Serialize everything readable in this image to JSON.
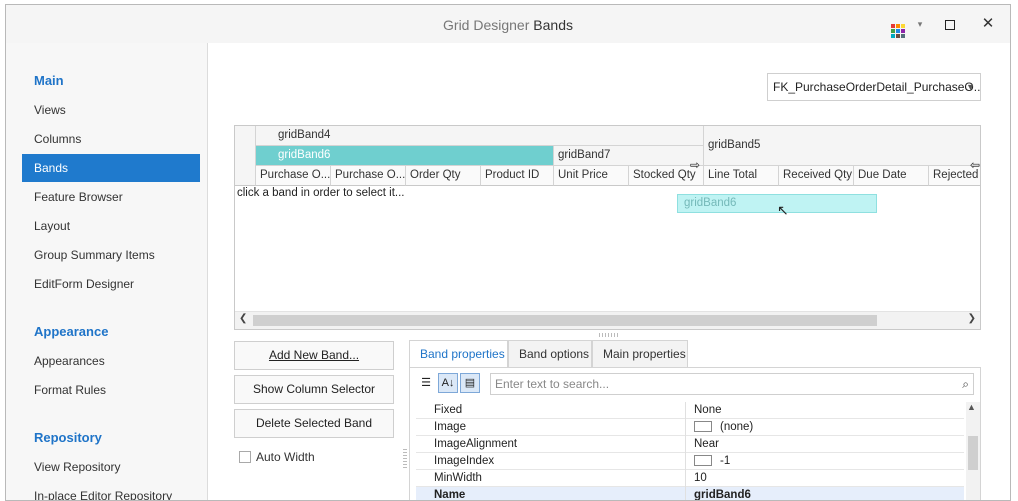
{
  "titlebar": {
    "title_part1": "Grid Designer",
    "title_part2": "Bands",
    "palette_icon": "palette-icon",
    "menu_arrow": "▾",
    "maximize": "maximize-icon",
    "close": "✕"
  },
  "sidebar": {
    "groups": [
      {
        "label": "Main"
      },
      {
        "label": "Appearance"
      },
      {
        "label": "Repository"
      }
    ],
    "items": [
      {
        "label": "Views"
      },
      {
        "label": "Columns"
      },
      {
        "label": "Bands"
      },
      {
        "label": "Feature Browser"
      },
      {
        "label": "Layout"
      },
      {
        "label": "Group Summary Items"
      },
      {
        "label": "EditForm Designer"
      },
      {
        "label": "Appearances"
      },
      {
        "label": "Format Rules"
      },
      {
        "label": "View Repository"
      },
      {
        "label": "In-place Editor Repository"
      }
    ],
    "selected_color": "#1f7acd"
  },
  "combo": {
    "value": "FK_PurchaseOrderDetail_PurchaseO..."
  },
  "grid": {
    "bands": {
      "band4": "gridBand4",
      "band6": "gridBand6",
      "band7": "gridBand7",
      "band5": "gridBand5"
    },
    "columns": [
      "Purchase O...",
      "Purchase O...",
      "Order Qty",
      "Product ID",
      "Unit Price",
      "Stocked Qty",
      "Line Total",
      "Received Qty",
      "Due Date",
      "Rejected Qty"
    ],
    "hint": "click a band in order to select it...",
    "dragging_band": "gridBand6",
    "selected_band_color": "#6fcfcf"
  },
  "buttons": {
    "add_new_band": "Add New Band...",
    "show_column_selector": "Show Column Selector",
    "delete_selected_band": "Delete Selected Band"
  },
  "auto_width": {
    "label": "Auto Width",
    "checked": false
  },
  "tabs": [
    {
      "label": "Band properties",
      "active": true
    },
    {
      "label": "Band options",
      "active": false
    },
    {
      "label": "Main properties",
      "active": false
    }
  ],
  "properties": {
    "search_placeholder": "Enter text to search...",
    "rows": [
      {
        "name": "Fixed",
        "value": "None"
      },
      {
        "name": "Image",
        "value": "(none)"
      },
      {
        "name": "ImageAlignment",
        "value": "Near"
      },
      {
        "name": "ImageIndex",
        "value": "-1"
      },
      {
        "name": "MinWidth",
        "value": "10"
      },
      {
        "name": "Name",
        "value": "gridBand6"
      }
    ]
  }
}
